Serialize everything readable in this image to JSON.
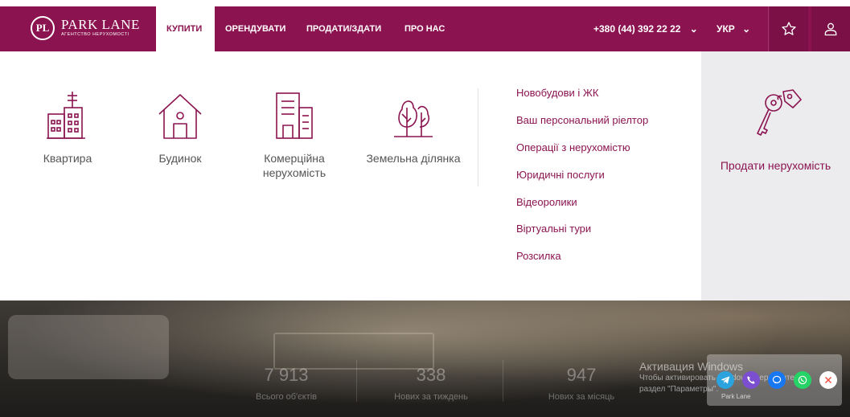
{
  "brand": {
    "monogram": "PL",
    "name": "PARK LANE",
    "tagline": "АГЕНТСТВО НЕРУХОМОСТІ",
    "color": "#8b1450"
  },
  "nav": {
    "items": [
      {
        "label": "КУПИТИ",
        "active": true
      },
      {
        "label": "ОРЕНДУВАТИ",
        "active": false
      },
      {
        "label": "ПРОДАТИ/ЗДАТИ",
        "active": false
      },
      {
        "label": "ПРО НАС",
        "active": false
      }
    ],
    "phone": "+380 (44) 392 22 22",
    "phone_caret": "⌄",
    "language": "УКР",
    "language_caret": "⌄",
    "favorites_icon": "star-icon",
    "profile_icon": "user-icon"
  },
  "menu": {
    "categories": [
      {
        "label": "Квартира",
        "icon": "apartment-building-icon"
      },
      {
        "label": "Будинок",
        "icon": "house-icon"
      },
      {
        "label": "Комерційна нерухомість",
        "icon": "office-building-icon"
      },
      {
        "label": "Земельна ділянка",
        "icon": "trees-land-icon"
      }
    ],
    "links": [
      "Новобудови і ЖК",
      "Ваш персональний ріелтор",
      "Операції з нерухомістю",
      "Юридичні послуги",
      "Відеоролики",
      "Віртуальні тури",
      "Розсилка"
    ],
    "sell": {
      "label": "Продати нерухомість",
      "icon": "keys-icon"
    }
  },
  "stats": [
    {
      "value": "7 913",
      "label": "Всього об'єктів"
    },
    {
      "value": "338",
      "label": "Нових за тиждень"
    },
    {
      "value": "947",
      "label": "Нових за місяць"
    }
  ],
  "os_watermark": {
    "title": "Активация Windows",
    "line1": "Чтобы активировать Windows, перейдите в",
    "line2": "раздел \"Параметры\"."
  },
  "chat_widget": {
    "caption": "Park Lane",
    "buttons": [
      "telegram-icon",
      "viber-icon",
      "messenger-icon",
      "whatsapp-icon",
      "close-icon"
    ]
  }
}
